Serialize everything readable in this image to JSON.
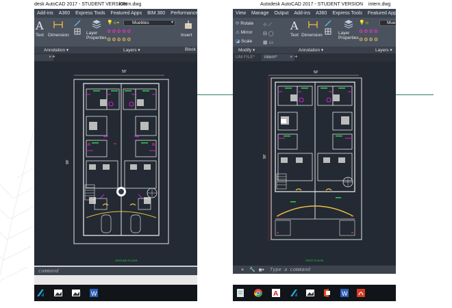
{
  "left_window": {
    "title": "desk AutoCAD 2017 - STUDENT VERSION",
    "filename": "intern.dwg",
    "menu": [
      "Add-ins",
      "A360",
      "Express Tools",
      "Featured Apps",
      "BIM 360",
      "Performance"
    ],
    "ribbon": {
      "text": "Text",
      "dimension": "Dimension",
      "layer_properties": "Layer\nProperties",
      "layer_name": "Muebles",
      "insert": "Insert"
    },
    "panels": [
      "Annotation ▾",
      "Layers ▾",
      "Block"
    ],
    "tab": "",
    "command_placeholder": "command",
    "drawing": {
      "width_dim": "50'",
      "height_dim": "90'",
      "caption": "GROUND FLOOR"
    }
  },
  "right_window": {
    "title": "Autodesk AutoCAD 2017 - STUDENT VERSION",
    "filename": "intern.dwg",
    "menu": [
      "View",
      "Manage",
      "Output",
      "Add-ins",
      "A360",
      "Express Tools",
      "Featured Apps"
    ],
    "ribbon": {
      "rotate": "Rotate",
      "mirror": "Mirror",
      "scale": "Scale",
      "text": "Text",
      "dimension": "Dimension",
      "layer_properties": "Layer\nProperties",
      "layer_name": "Mueb"
    },
    "panels": [
      "Modify ▾",
      "Annotation ▾",
      "Layers ▾"
    ],
    "tabs": [
      "UM FILE*",
      "intern*"
    ],
    "command_placeholder": "Type a command",
    "drawing": {
      "width_dim": "50'",
      "height_dim": "90'",
      "caption": "FIRST FLOOR"
    }
  },
  "colors": {
    "canvas": "#232a33",
    "wall": "#e6e6e6",
    "magenta": "#d020d0",
    "green": "#2bd04a",
    "accent_line": "#2e7d5e"
  },
  "taskbar_icons": [
    "autodesk-icon",
    "photos-icon",
    "word-icon",
    "chrome-icon",
    "office-icon",
    "pdf-icon"
  ]
}
